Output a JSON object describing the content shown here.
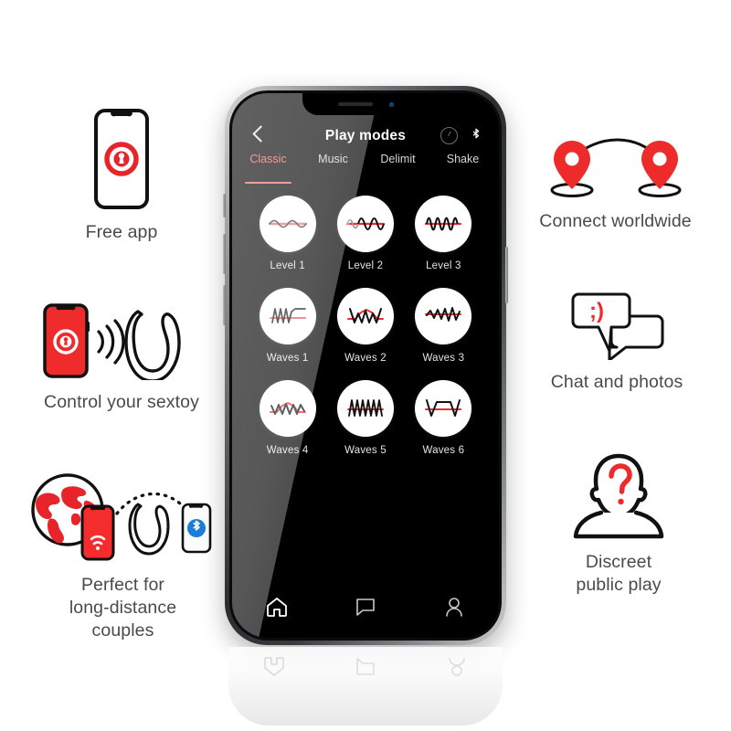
{
  "features_left": [
    {
      "id": "free-app",
      "icon": "phone-with-app-logo-icon",
      "caption": "Free app"
    },
    {
      "id": "control-sextoy",
      "icon": "phone-signal-toy-icon",
      "caption": "Control your sextoy"
    },
    {
      "id": "long-distance",
      "icon": "globe-phone-toy-bluetooth-icon",
      "caption": "Perfect for\nlong-distance\ncouples"
    }
  ],
  "features_right": [
    {
      "id": "connect-worldwide",
      "icon": "two-map-pins-arc-icon",
      "caption": "Connect worldwide"
    },
    {
      "id": "chat-photos",
      "icon": "speech-bubbles-icon",
      "emoticon": ";)",
      "caption": "Chat and photos"
    },
    {
      "id": "discreet-play",
      "icon": "anonymous-person-question-icon",
      "caption": "Discreet\npublic play"
    }
  ],
  "phone": {
    "status_icons": [
      "battery-circle-icon",
      "bluetooth-icon"
    ],
    "app": {
      "back_label": "‹",
      "title": "Play modes",
      "tabs": [
        {
          "label": "Classic",
          "active": true
        },
        {
          "label": "Music",
          "active": false
        },
        {
          "label": "Delimit",
          "active": false
        },
        {
          "label": "Shake",
          "active": false
        }
      ],
      "modes": [
        {
          "label": "Level 1",
          "wave": "sine-low"
        },
        {
          "label": "Level 2",
          "wave": "sine-mid"
        },
        {
          "label": "Level 3",
          "wave": "sine-high"
        },
        {
          "label": "Waves 1",
          "wave": "ramp-plateau"
        },
        {
          "label": "Waves 2",
          "wave": "zigzag-valley"
        },
        {
          "label": "Waves 3",
          "wave": "zigzag-rising"
        },
        {
          "label": "Waves 4",
          "wave": "zigzag-arch"
        },
        {
          "label": "Waves 5",
          "wave": "triangle-dense"
        },
        {
          "label": "Waves 6",
          "wave": "trapezoid"
        }
      ],
      "navbar": [
        {
          "icon": "home-icon",
          "label": "Home",
          "active": true
        },
        {
          "icon": "chat-bubble-icon",
          "label": "Chat",
          "active": false
        },
        {
          "icon": "profile-icon",
          "label": "Profile",
          "active": false
        }
      ]
    }
  },
  "colors": {
    "brand_red": "#e8242b",
    "accent_salmon": "#f0635f",
    "wave_red": "#ee2b30",
    "text_grey": "#4a4a4a",
    "bluetooth_blue": "#1c7ed6"
  }
}
